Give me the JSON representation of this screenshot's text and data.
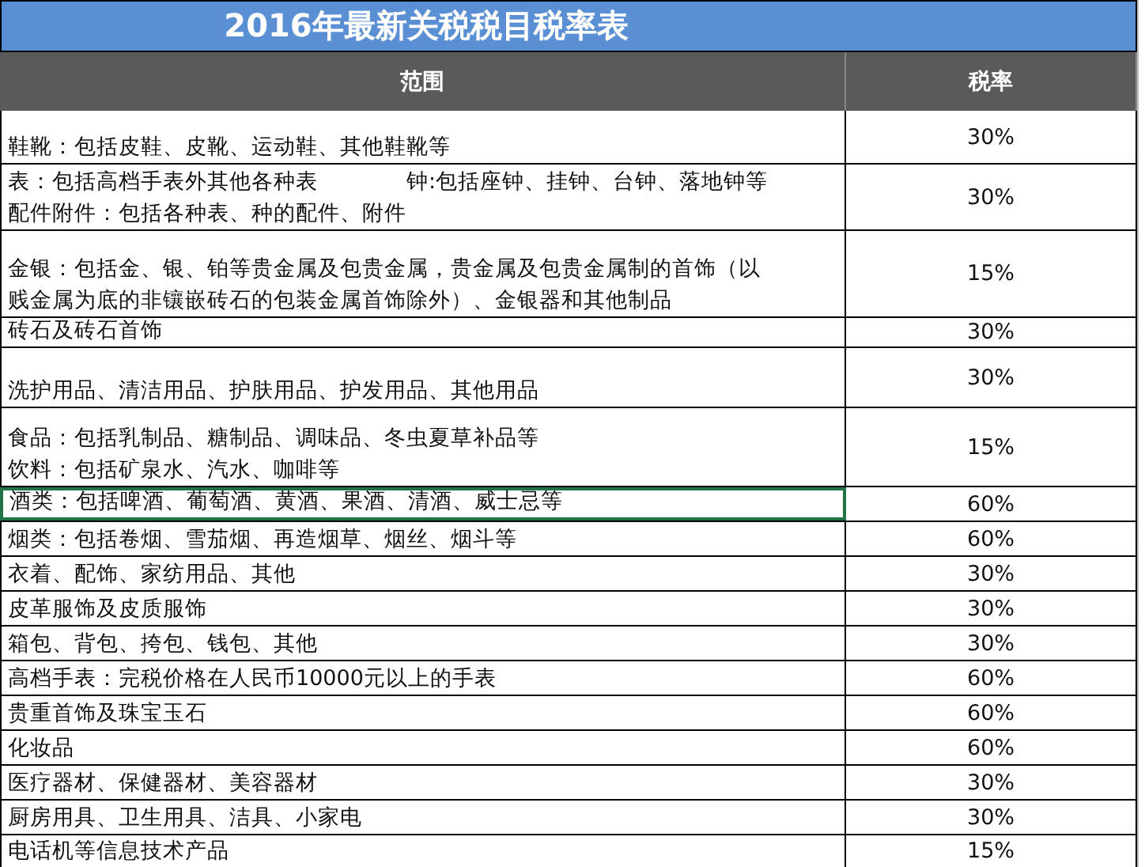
{
  "title": "2016年最新关税税目税率表",
  "table": {
    "columns": [
      "范围",
      "税率"
    ],
    "rows": [
      {
        "lines": [
          "鞋靴：包括皮鞋、皮靴、运动鞋、其他鞋靴等"
        ],
        "rate": "30%",
        "selected": false
      },
      {
        "lines": [
          "表：包括高档手表外其他各种表　　　　钟:包括座钟、挂钟、台钟、落地钟等",
          "配件附件：包括各种表、种的配件、附件"
        ],
        "rate": "30%",
        "selected": false
      },
      {
        "lines": [
          "金银：包括金、银、铂等贵金属及包贵金属，贵金属及包贵金属制的首饰（以",
          "贱金属为底的非镶嵌砖石的包装金属首饰除外）、金银器和其他制品"
        ],
        "rate": "15%",
        "selected": false
      },
      {
        "lines": [
          "砖石及砖石首饰"
        ],
        "rate": "30%",
        "selected": false
      },
      {
        "lines": [
          "洗护用品、清洁用品、护肤用品、护发用品、其他用品"
        ],
        "rate": "30%",
        "selected": false
      },
      {
        "lines": [
          "食品：包括乳制品、糖制品、调味品、冬虫夏草补品等",
          "饮料：包括矿泉水、汽水、咖啡等"
        ],
        "rate": "15%",
        "selected": false
      },
      {
        "lines": [
          "酒类：包括啤酒、葡萄酒、黄酒、果酒、清酒、威士忌等"
        ],
        "rate": "60%",
        "selected": true
      },
      {
        "lines": [
          "烟类：包括卷烟、雪茄烟、再造烟草、烟丝、烟斗等"
        ],
        "rate": "60%",
        "selected": false
      },
      {
        "lines": [
          "衣着、配饰、家纺用品、其他"
        ],
        "rate": "30%",
        "selected": false
      },
      {
        "lines": [
          "皮革服饰及皮质服饰"
        ],
        "rate": "30%",
        "selected": false
      },
      {
        "lines": [
          "箱包、背包、挎包、钱包、其他"
        ],
        "rate": "30%",
        "selected": false
      },
      {
        "lines": [
          "高档手表：完税价格在人民币10000元以上的手表"
        ],
        "rate": "60%",
        "selected": false
      },
      {
        "lines": [
          "贵重首饰及珠宝玉石"
        ],
        "rate": "60%",
        "selected": false
      },
      {
        "lines": [
          "化妆品"
        ],
        "rate": "60%",
        "selected": false
      },
      {
        "lines": [
          "医疗器材、保健器材、美容器材"
        ],
        "rate": "30%",
        "selected": false
      },
      {
        "lines": [
          "厨房用具、卫生用具、洁具、小家电"
        ],
        "rate": "30%",
        "selected": false
      },
      {
        "lines": [
          "电话机等信息技术产品"
        ],
        "rate": "15%",
        "selected": false
      }
    ]
  }
}
